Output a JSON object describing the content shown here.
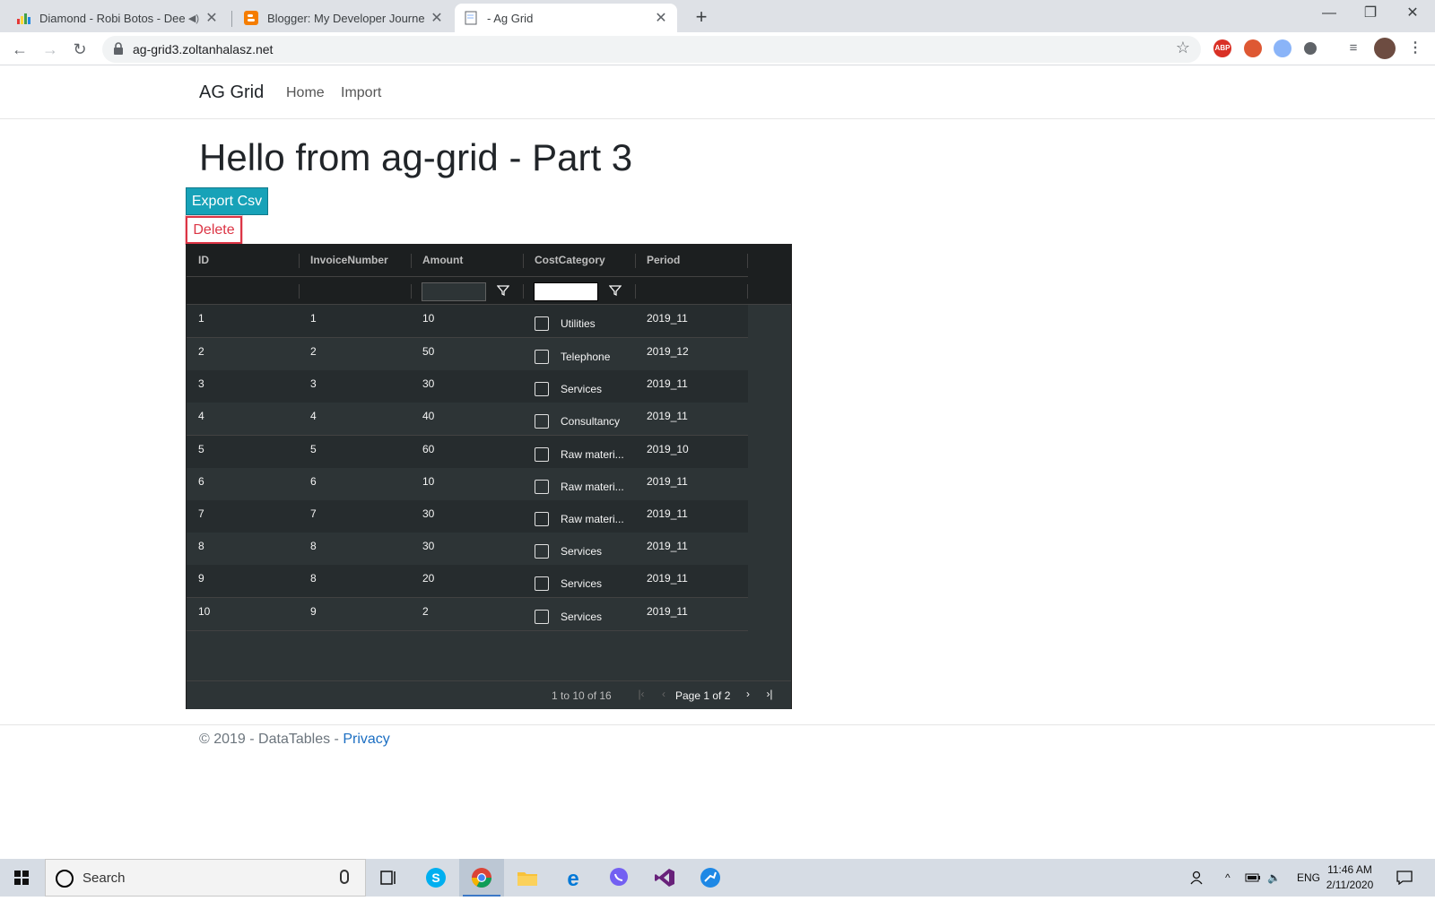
{
  "browser": {
    "tabs": [
      {
        "title": "Diamond - Robi Botos - Dee",
        "active": false
      },
      {
        "title": "Blogger: My Developer Journey -",
        "active": false
      },
      {
        "title": "- Ag Grid",
        "active": true
      }
    ],
    "url": "ag-grid3.zoltanhalasz.net",
    "extensions": [
      "ABP",
      "duckduckgo-icon",
      "extension-icon",
      "circle-icon"
    ]
  },
  "navbar": {
    "brand": "AG Grid",
    "links": [
      "Home",
      "Import"
    ]
  },
  "page": {
    "heading": "Hello from ag-grid - Part 3",
    "export_label": "Export Csv",
    "delete_label": "Delete"
  },
  "grid": {
    "columns": [
      "ID",
      "InvoiceNumber",
      "Amount",
      "CostCategory",
      "Period"
    ],
    "rows": [
      {
        "id": "1",
        "invoice": "1",
        "amount": "10",
        "category": "Utilities",
        "period": "2019_11"
      },
      {
        "id": "2",
        "invoice": "2",
        "amount": "50",
        "category": "Telephone",
        "period": "2019_12"
      },
      {
        "id": "3",
        "invoice": "3",
        "amount": "30",
        "category": "Services",
        "period": "2019_11"
      },
      {
        "id": "4",
        "invoice": "4",
        "amount": "40",
        "category": "Consultancy",
        "period": "2019_11"
      },
      {
        "id": "5",
        "invoice": "5",
        "amount": "60",
        "category": "Raw materi...",
        "period": "2019_10"
      },
      {
        "id": "6",
        "invoice": "6",
        "amount": "10",
        "category": "Raw materi...",
        "period": "2019_11"
      },
      {
        "id": "7",
        "invoice": "7",
        "amount": "30",
        "category": "Raw materi...",
        "period": "2019_11"
      },
      {
        "id": "8",
        "invoice": "8",
        "amount": "30",
        "category": "Services",
        "period": "2019_11"
      },
      {
        "id": "9",
        "invoice": "8",
        "amount": "20",
        "category": "Services",
        "period": "2019_11"
      },
      {
        "id": "10",
        "invoice": "9",
        "amount": "2",
        "category": "Services",
        "period": "2019_11"
      }
    ],
    "paging": {
      "summary": "1 to 10 of 16",
      "page_label": "Page 1 of 2"
    }
  },
  "footer": {
    "text": "© 2019 - DataTables - ",
    "link": "Privacy"
  },
  "taskbar": {
    "search_placeholder": "Search",
    "language": "ENG",
    "time": "11:46 AM",
    "date": "2/11/2020"
  }
}
